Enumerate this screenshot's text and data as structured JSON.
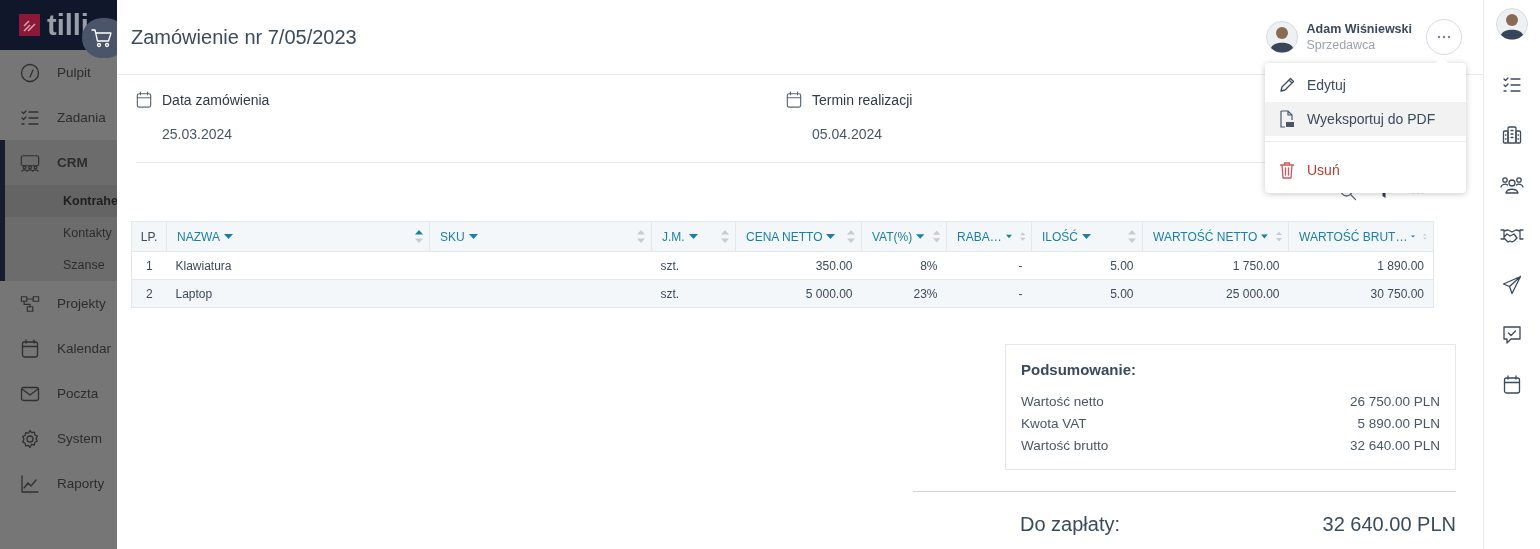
{
  "sidebar": {
    "logo": "tilli",
    "items": [
      {
        "label": "Pulpit",
        "selected": false
      },
      {
        "label": "Zadania",
        "selected": false
      },
      {
        "label": "CRM",
        "selected": true,
        "expanded": true,
        "children": [
          {
            "label": "Kontrahe",
            "selected": true
          },
          {
            "label": "Kontakty",
            "selected": false
          },
          {
            "label": "Szanse",
            "selected": false
          }
        ]
      },
      {
        "label": "Projekty",
        "selected": false
      },
      {
        "label": "Kalendar",
        "selected": false
      },
      {
        "label": "Poczta",
        "selected": false
      },
      {
        "label": "System",
        "selected": false
      },
      {
        "label": "Raporty",
        "selected": false
      }
    ]
  },
  "header": {
    "title": "Zamówienie nr 7/05/2023",
    "user": {
      "name": "Adam Wiśniewski",
      "role": "Sprzedawca"
    }
  },
  "menu": {
    "items": [
      {
        "label": "Edytuj",
        "kind": "edit",
        "selected": false
      },
      {
        "label": "Wyeksportuj do PDF",
        "kind": "pdf",
        "selected": true
      },
      {
        "label": "Usuń",
        "kind": "delete",
        "selected": false
      }
    ]
  },
  "dates": [
    {
      "label": "Data zamówienia",
      "value": "25.03.2024"
    },
    {
      "label": "Termin realizacji",
      "value": "05.04.2024"
    }
  ],
  "table": {
    "columns": [
      {
        "label": "LP.",
        "filter": false,
        "sortable": false
      },
      {
        "label": "NAZWA",
        "filter": true,
        "sortable": true,
        "sorted": true
      },
      {
        "label": "SKU",
        "filter": true,
        "sortable": true,
        "sorted": false
      },
      {
        "label": "J.M.",
        "filter": true,
        "sortable": true,
        "sorted": false
      },
      {
        "label": "CENA NETTO",
        "filter": true,
        "sortable": true,
        "sorted": false
      },
      {
        "label": "VAT(%)",
        "filter": true,
        "sortable": true,
        "sorted": false
      },
      {
        "label": "RABA…",
        "filter": true,
        "sortable": true,
        "sorted": false
      },
      {
        "label": "ILOŚĆ",
        "filter": true,
        "sortable": true,
        "sorted": false
      },
      {
        "label": "WARTOŚĆ NETTO",
        "filter": true,
        "sortable": true,
        "sorted": false
      },
      {
        "label": "WARTOŚĆ BRUT…",
        "filter": true,
        "sortable": true,
        "sorted": false
      }
    ],
    "rows": [
      [
        "1",
        "Klawiatura",
        null,
        "szt.",
        "350.00",
        "8%",
        "-",
        "5.00",
        "1 750.00",
        "1 890.00"
      ],
      [
        "2",
        "Laptop",
        null,
        "szt.",
        "5 000.00",
        "23%",
        "-",
        "5.00",
        "25 000.00",
        "30 750.00"
      ]
    ]
  },
  "summary": {
    "title": "Podsumowanie:",
    "lines": [
      {
        "label": "Wartość netto",
        "value": "26 750.00 PLN"
      },
      {
        "label": "Kwota VAT",
        "value": "5 890.00 PLN"
      },
      {
        "label": "Wartość brutto",
        "value": "32 640.00 PLN"
      }
    ],
    "total": {
      "label": "Do zapłaty:",
      "value": "32 640.00 PLN"
    }
  }
}
